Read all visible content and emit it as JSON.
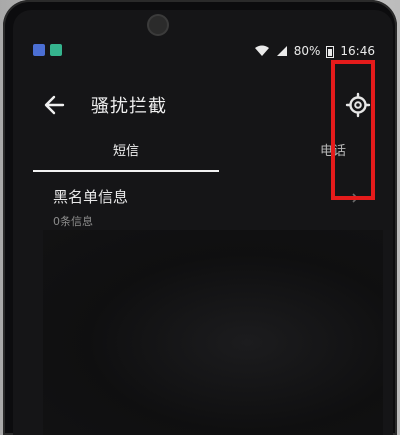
{
  "status_bar": {
    "battery": "80%",
    "time": "16:46",
    "icons": [
      "notification-blue-icon",
      "notification-green-icon",
      "wifi-icon",
      "signal-icon",
      "battery-icon"
    ]
  },
  "header": {
    "title": "骚扰拦截",
    "back_icon": "back-arrow-icon",
    "settings_icon": "gear-icon"
  },
  "tabs": [
    {
      "label": "短信",
      "active": true
    },
    {
      "label": "电话",
      "active": false
    }
  ],
  "list": [
    {
      "title": "黑名单信息",
      "subtitle": "0条信息"
    }
  ],
  "colors": {
    "screen_bg": "#151517",
    "text_primary": "#f0f0f0",
    "text_secondary": "#8c8c8c",
    "highlight": "#e51b1b"
  }
}
